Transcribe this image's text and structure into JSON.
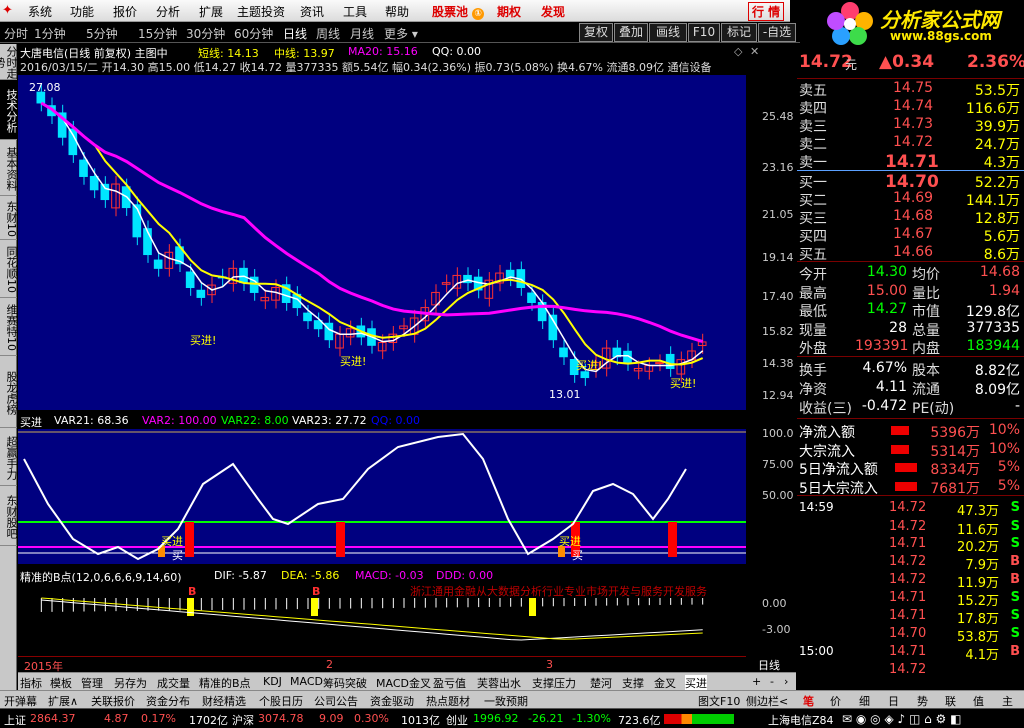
{
  "menu": {
    "items": [
      "系统",
      "功能",
      "报价",
      "分析",
      "扩展",
      "主题投资",
      "资讯",
      "工具",
      "帮助"
    ],
    "stockpool": "股票池",
    "options": "期权",
    "discover": "发现",
    "quote": "行 情",
    "info": "资"
  },
  "logo": {
    "main": "分析家公式网",
    "url": "www.88gs.com"
  },
  "periods": [
    "分时",
    "1分钟",
    "5分钟",
    "15分钟",
    "30分钟",
    "60分钟",
    "日线",
    "周线",
    "月线",
    "更多"
  ],
  "toolbar": [
    "复权",
    "叠加",
    "画线",
    "F10",
    "标记",
    "-自选"
  ],
  "leftbar": [
    "分时走势",
    "技术分析",
    "基本资料",
    "东财10",
    "同花顺10",
    "维赛特10",
    "股龙虎榜",
    "超赢手力",
    "东财股吧"
  ],
  "main": {
    "name": "大唐电信(日线 前复权) 主图中",
    "ma": [
      {
        "label": "短线: 14.13",
        "color": "#ffff00"
      },
      {
        "label": "中线: 13.97",
        "color": "#ffff00"
      },
      {
        "label": "MA20: 15.16",
        "color": "#ff00ff"
      },
      {
        "label": "QQ: 0.00",
        "color": "#ffffff"
      }
    ],
    "info": "2016/03/15/二 开14.30 高15.00 低14.27 收14.72 量377335 额5.54亿 幅0.34(2.36%) 振0.73(5.08%) 换4.67% 流通8.09亿 通信设备",
    "high_label": "27.08",
    "low_label": "13.01",
    "buy": "买进!",
    "yaxis": [
      "25.48",
      "23.16",
      "21.05",
      "19.14",
      "17.40",
      "15.82",
      "14.38",
      "12.94"
    ]
  },
  "ind1": {
    "name": "买进",
    "vars": [
      {
        "label": "VAR21: 68.36",
        "color": "#ffffff"
      },
      {
        "label": "VAR2: 100.00",
        "color": "#ff00ff"
      },
      {
        "label": "VAR22: 8.00",
        "color": "#00ff00"
      },
      {
        "label": "VAR23: 27.72",
        "color": "#ffffff"
      },
      {
        "label": "QQ: 0.00",
        "color": "#0000ff"
      }
    ],
    "yaxis": [
      "100.0",
      "75.00",
      "50.00"
    ],
    "buy": "买进",
    "buy2": "买"
  },
  "ind2": {
    "name": "精准的B点(12,0,6,6,6,9,14,60)",
    "vars": [
      {
        "label": "DIF: -5.87",
        "color": "#ffffff"
      },
      {
        "label": "DEA: -5.86",
        "color": "#ffff00"
      },
      {
        "label": "MACD: -0.03",
        "color": "#ff00ff"
      },
      {
        "label": "DDD: 0.00",
        "color": "#ff00ff"
      }
    ],
    "yaxis": [
      "0.00",
      "-3.00"
    ],
    "b": "B",
    "scroll": "浙江通用金融从大数据分析行业专业市场开发与服务开发服务"
  },
  "xaxis": {
    "year": "2015年",
    "m2": "2",
    "m3": "3",
    "period": "日线"
  },
  "bottomtabs": [
    "指标",
    "模板",
    "管理",
    "另存为",
    "成交量",
    "精准的B点",
    "KDJ",
    "MACD",
    "筹码突破",
    "MACD金叉",
    "盈亏值",
    "芙蓉出水",
    "支撑压力",
    "楚河",
    "支撑",
    "金叉",
    "买进"
  ],
  "quote": {
    "price": "14.72",
    "unit": "元",
    "change": "▲0.34",
    "pct": "2.36%",
    "asks": [
      {
        "l": "卖五",
        "p": "14.75",
        "v": "53.5万"
      },
      {
        "l": "卖四",
        "p": "14.74",
        "v": "116.6万"
      },
      {
        "l": "卖三",
        "p": "14.73",
        "v": "39.9万"
      },
      {
        "l": "卖二",
        "p": "14.72",
        "v": "24.7万"
      },
      {
        "l": "卖一",
        "p": "14.71",
        "v": "4.3万"
      }
    ],
    "bids": [
      {
        "l": "买一",
        "p": "14.70",
        "v": "52.2万"
      },
      {
        "l": "买二",
        "p": "14.69",
        "v": "144.1万"
      },
      {
        "l": "买三",
        "p": "14.68",
        "v": "12.8万"
      },
      {
        "l": "买四",
        "p": "14.67",
        "v": "5.6万"
      },
      {
        "l": "买五",
        "p": "14.66",
        "v": "8.6万"
      }
    ],
    "stats": [
      {
        "l": "今开",
        "v": "14.30",
        "vc": "#00ff00",
        "l2": "均价",
        "v2": "14.68",
        "v2c": "#ff5050"
      },
      {
        "l": "最高",
        "v": "15.00",
        "vc": "#ff5050",
        "l2": "量比",
        "v2": "1.94",
        "v2c": "#ff5050"
      },
      {
        "l": "最低",
        "v": "14.27",
        "vc": "#00ff00",
        "l2": "市值",
        "v2": "129.8亿",
        "v2c": "#ffffff"
      },
      {
        "l": "现量",
        "v": "28",
        "vc": "#ffffff",
        "l2": "总量",
        "v2": "377335",
        "v2c": "#ffffff"
      },
      {
        "l": "外盘",
        "v": "193391",
        "vc": "#ff5050",
        "l2": "内盘",
        "v2": "183944",
        "v2c": "#00ff00"
      },
      {
        "l": "换手",
        "v": "4.67%",
        "vc": "#ffffff",
        "l2": "股本",
        "v2": "8.82亿",
        "v2c": "#ffffff"
      },
      {
        "l": "净资",
        "v": "4.11",
        "vc": "#ffffff",
        "l2": "流通",
        "v2": "8.09亿",
        "v2c": "#ffffff"
      },
      {
        "l": "收益(三)",
        "v": "-0.472",
        "vc": "#ffffff",
        "l2": "PE(动)",
        "v2": "-",
        "v2c": "#ffffff"
      }
    ],
    "flows": [
      {
        "l": "净流入额",
        "v": "5396万",
        "p": "10%"
      },
      {
        "l": "大宗流入",
        "v": "5314万",
        "p": "10%"
      },
      {
        "l": "5日净流入额",
        "v": "8334万",
        "p": "5%"
      },
      {
        "l": "5日大宗流入",
        "v": "7681万",
        "p": "5%"
      }
    ],
    "ticks": [
      {
        "t": "14:59",
        "p": "14.72",
        "v": "47.3万",
        "d": "S"
      },
      {
        "t": "",
        "p": "14.72",
        "v": "11.6万",
        "d": "S"
      },
      {
        "t": "",
        "p": "14.71",
        "v": "20.2万",
        "d": "S"
      },
      {
        "t": "",
        "p": "14.72",
        "v": "7.9万",
        "d": "B"
      },
      {
        "t": "",
        "p": "14.72",
        "v": "11.9万",
        "d": "B"
      },
      {
        "t": "",
        "p": "14.71",
        "v": "15.2万",
        "d": "S"
      },
      {
        "t": "",
        "p": "14.71",
        "v": "17.8万",
        "d": "S"
      },
      {
        "t": "",
        "p": "14.70",
        "v": "53.8万",
        "d": "S"
      },
      {
        "t": "15:00",
        "p": "14.71",
        "v": "4.1万",
        "d": "B"
      },
      {
        "t": "",
        "p": "14.72",
        "v": "",
        "d": ""
      }
    ],
    "tabs": [
      "笔",
      "价",
      "细",
      "日",
      "势",
      "联",
      "值",
      "主"
    ]
  },
  "status1": [
    "开弹幕",
    "扩展∧",
    "关联报价",
    "资金分布",
    "财经精选",
    "个股日历",
    "公司公告",
    "资金驱动",
    "热点题材",
    "一致预期"
  ],
  "status1_right": [
    "图文F10",
    "侧边栏<"
  ],
  "status2": {
    "sh_label": "上证",
    "sh": "2864.37",
    "sh_chg": "4.87",
    "sh_pct": "0.17%",
    "sh_amt": "1702亿",
    "sz_label": "沪深",
    "sz": "3074.78",
    "sz_chg": "9.09",
    "sz_pct": "0.30%",
    "sz_amt": "1013亿",
    "cy_label": "创业",
    "cy": "1996.92",
    "cy_chg": "-26.21",
    "cy_pct": "-1.30%",
    "cy_amt": "723.6亿",
    "right": "上海电信Z84"
  }
}
